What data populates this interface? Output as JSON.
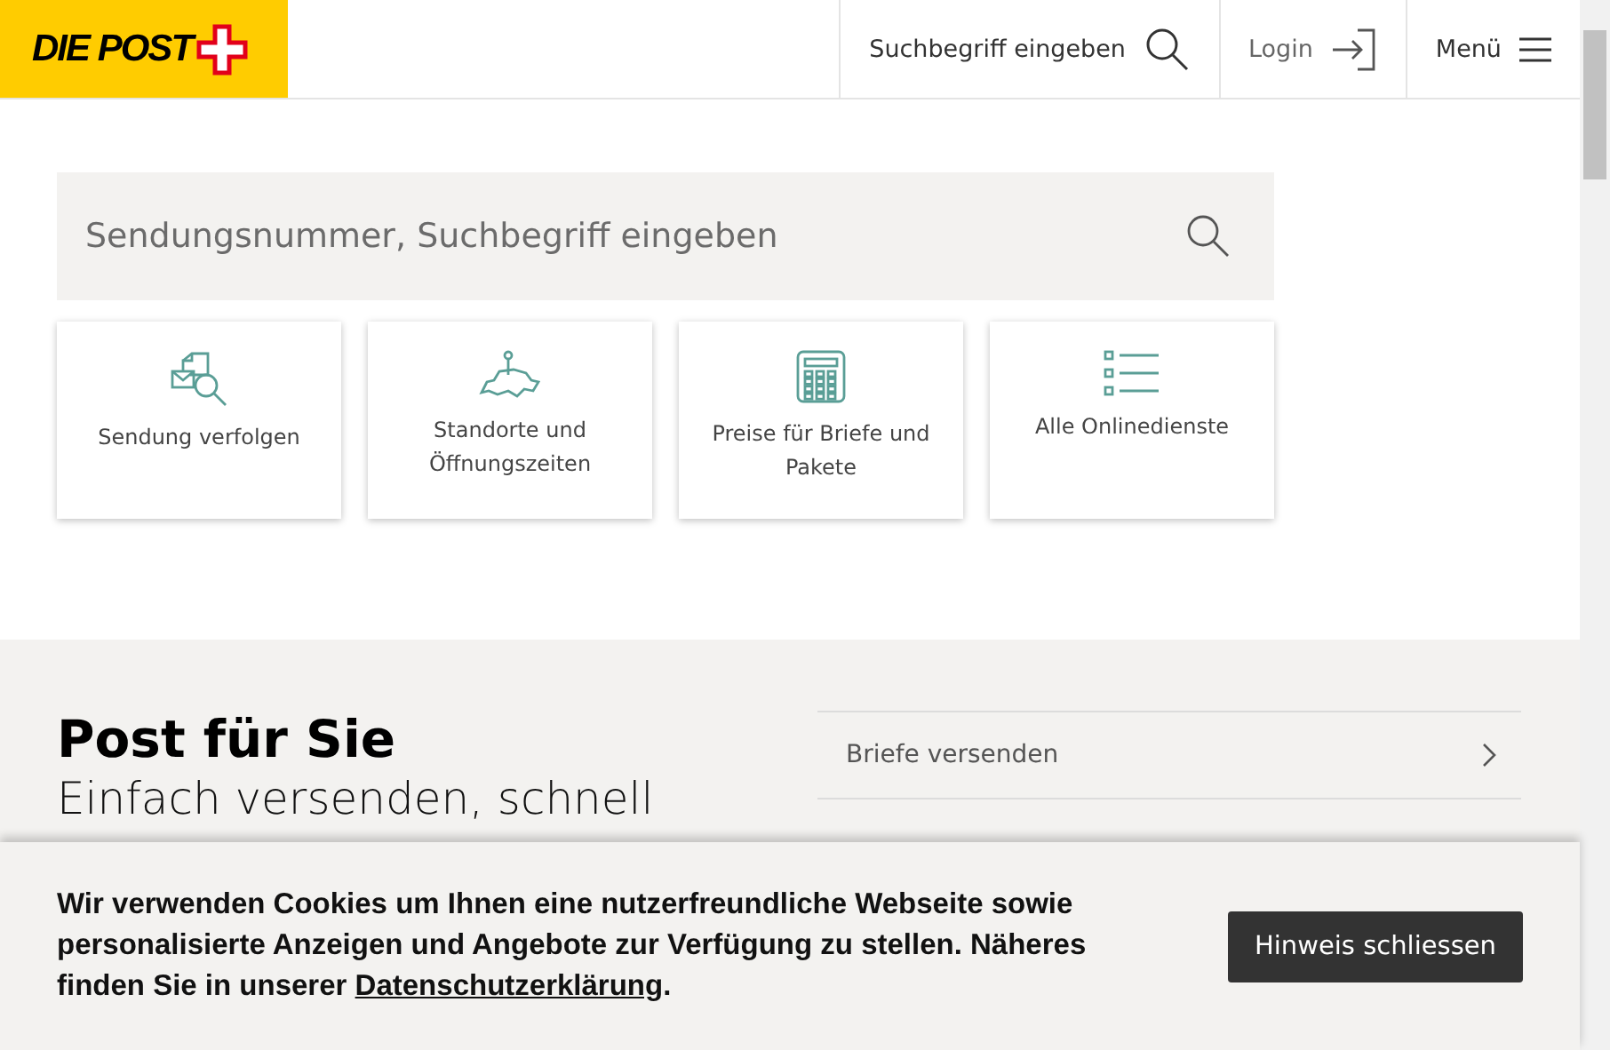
{
  "header": {
    "logo": "DIE POST",
    "search_label": "Suchbegriff eingeben",
    "login": "Login",
    "menu": "Menü"
  },
  "search": {
    "placeholder": "Sendungsnummer, Suchbegriff eingeben"
  },
  "tiles": [
    {
      "kind": "track",
      "label": "Sendung verfolgen"
    },
    {
      "kind": "map",
      "label": "Standorte und Öffnungszeiten"
    },
    {
      "kind": "calculator",
      "label": "Preise für Briefe und Pakete"
    },
    {
      "kind": "list",
      "label": "Alle Onlinedienste"
    }
  ],
  "section": {
    "title": "Post für Sie",
    "subtitle": "Einfach versenden, schnell",
    "links": [
      "Briefe versenden"
    ]
  },
  "cookie_banner": {
    "text_before": "Wir verwenden Cookies um Ihnen eine nutzerfreundliche Webseite sowie personalisierte Anzeigen und Angebote zur Verfügung zu stellen. Näheres finden Sie in unserer ",
    "link": "Datenschutzerklärung",
    "text_after": ".",
    "button": "Hinweis schliessen"
  }
}
